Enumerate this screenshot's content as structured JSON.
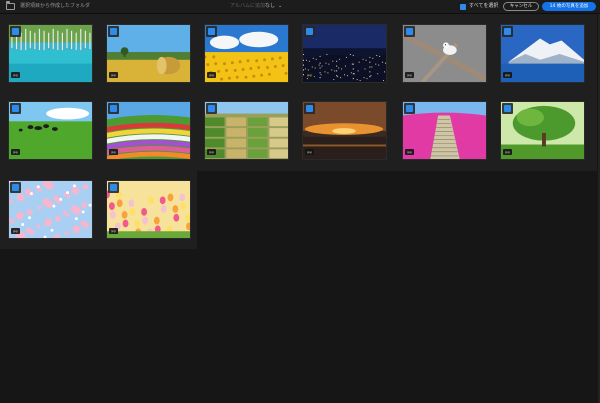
{
  "header": {
    "folder_title": "選択項目から作成したフォルダ",
    "album_label": "アルバムに追加",
    "album_value": "なし",
    "select_all_label": "すべてを選択",
    "cancel_label": "キャンセル",
    "add_label": "14 枚の写真を追加"
  },
  "photos": [
    {
      "subject": "blue-pond",
      "format": "jpg",
      "selected": true
    },
    {
      "subject": "hay-bale-field",
      "format": "jpg",
      "selected": true
    },
    {
      "subject": "sunflower-field",
      "format": "jpg",
      "selected": true
    },
    {
      "subject": "night-city-view",
      "format": "jpg",
      "selected": true
    },
    {
      "subject": "white-bird-on-branch",
      "format": "jpg",
      "selected": true
    },
    {
      "subject": "snowy-mountain-lake",
      "format": "jpg",
      "selected": true
    },
    {
      "subject": "cows-in-pasture",
      "format": "jpg",
      "selected": true
    },
    {
      "subject": "flower-stripe-hills",
      "format": "jpg",
      "selected": true
    },
    {
      "subject": "farmland-aerial",
      "format": "jpg",
      "selected": true
    },
    {
      "subject": "sunset-clouds",
      "format": "jpg",
      "selected": true
    },
    {
      "subject": "pink-moss-path",
      "format": "jpg",
      "selected": true
    },
    {
      "subject": "green-tree",
      "format": "jpg",
      "selected": true
    },
    {
      "subject": "cherry-blossoms",
      "format": "jpg",
      "selected": true
    },
    {
      "subject": "tulip-field",
      "format": "jpg",
      "selected": true
    }
  ]
}
